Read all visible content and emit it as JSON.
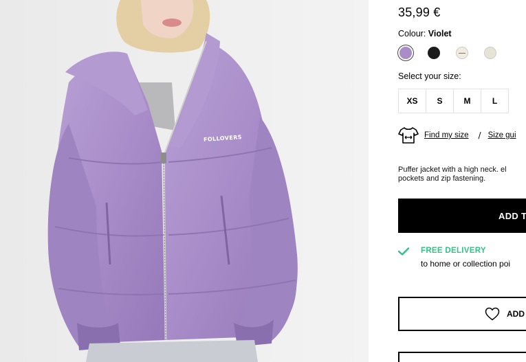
{
  "product": {
    "price": "35,99 €",
    "colour_label": "Colour:",
    "colour_value": "Violet",
    "swatches": [
      {
        "name": "Violet",
        "color": "#a98dc8",
        "selected": true
      },
      {
        "name": "Black",
        "color": "#1c1c1c",
        "selected": false
      },
      {
        "name": "Cream",
        "color": "#f1ebe0",
        "selected": false
      },
      {
        "name": "Beige",
        "color": "#e6e4d4",
        "selected": false
      }
    ],
    "size_prompt": "Select your size:",
    "sizes": [
      "XS",
      "S",
      "M",
      "L"
    ],
    "find_my_size": "Find my size",
    "separator": "/",
    "size_guide": "Size gui",
    "description_line1": "Puffer jacket with a high neck. el",
    "description_line2": "pockets and zip fastening.",
    "add_to_bag": "ADD T",
    "delivery_title": "FREE DELIVERY",
    "delivery_sub": "to home or collection poi",
    "wishlist": "ADD"
  },
  "image": {
    "jacket_print": "FOLLOVERS"
  },
  "colors": {
    "delivery_green": "#2ec486",
    "jacket_violet": "#a98dc8"
  }
}
